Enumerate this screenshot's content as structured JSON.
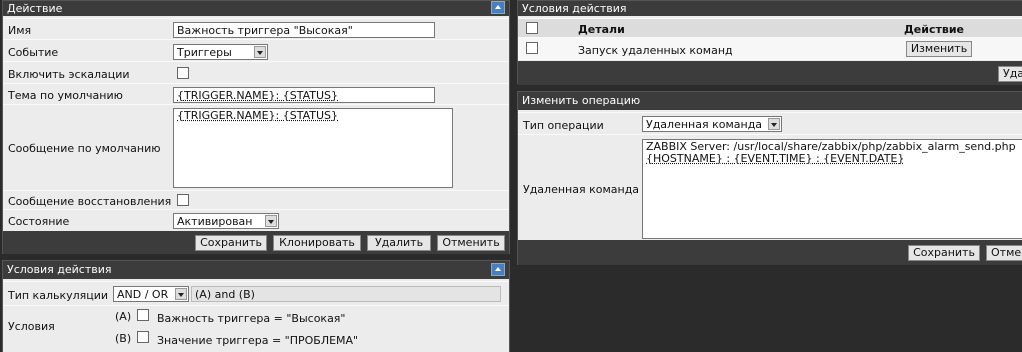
{
  "action_panel": {
    "title": "Действие",
    "name_label": "Имя",
    "name_value": "Важность триггера \"Высокая\"",
    "event_label": "Событие",
    "event_value": "Триггеры",
    "escalation_label": "Включить эскалации",
    "subject_label": "Тема по умолчанию",
    "subject_value": "{TRIGGER.NAME}: {STATUS}",
    "message_label": "Сообщение по умолчанию",
    "message_value": "{TRIGGER.NAME}: {STATUS}",
    "recovery_label": "Сообщение восстановления",
    "status_label": "Состояние",
    "status_value": "Активирован",
    "buttons": {
      "save": "Сохранить",
      "clone": "Клонировать",
      "delete": "Удалить",
      "cancel": "Отменить"
    }
  },
  "conditions_panel": {
    "title": "Условия действия",
    "calc_label": "Тип калькуляции",
    "calc_value": "AND / OR",
    "calc_formula": "(A) and (B)",
    "conditions_label": "Условия",
    "items": [
      {
        "tag": "(A)",
        "text": "Важность триггера = \"Высокая\""
      },
      {
        "tag": "(B)",
        "text": "Значение триггера = \"ПРОБЛЕМА\""
      }
    ]
  },
  "operations_panel": {
    "title": "Условия действия",
    "col_details": "Детали",
    "col_action": "Действие",
    "row_details": "Запуск удаленных команд",
    "row_button": "Изменить",
    "delete_partial": "Уда"
  },
  "edit_operation_panel": {
    "title": "Изменить операцию",
    "type_label": "Тип операции",
    "type_value": "Удаленная команда",
    "command_label": "Удаленная команда",
    "command_line1": "ZABBIX Server: /usr/local/share/zabbix/php/zabbix_alarm_send.php",
    "command_line2": "{HOSTNAME} : {EVENT.TIME} : {EVENT.DATE}",
    "save": "Сохранить",
    "cancel_partial": "Отме"
  }
}
